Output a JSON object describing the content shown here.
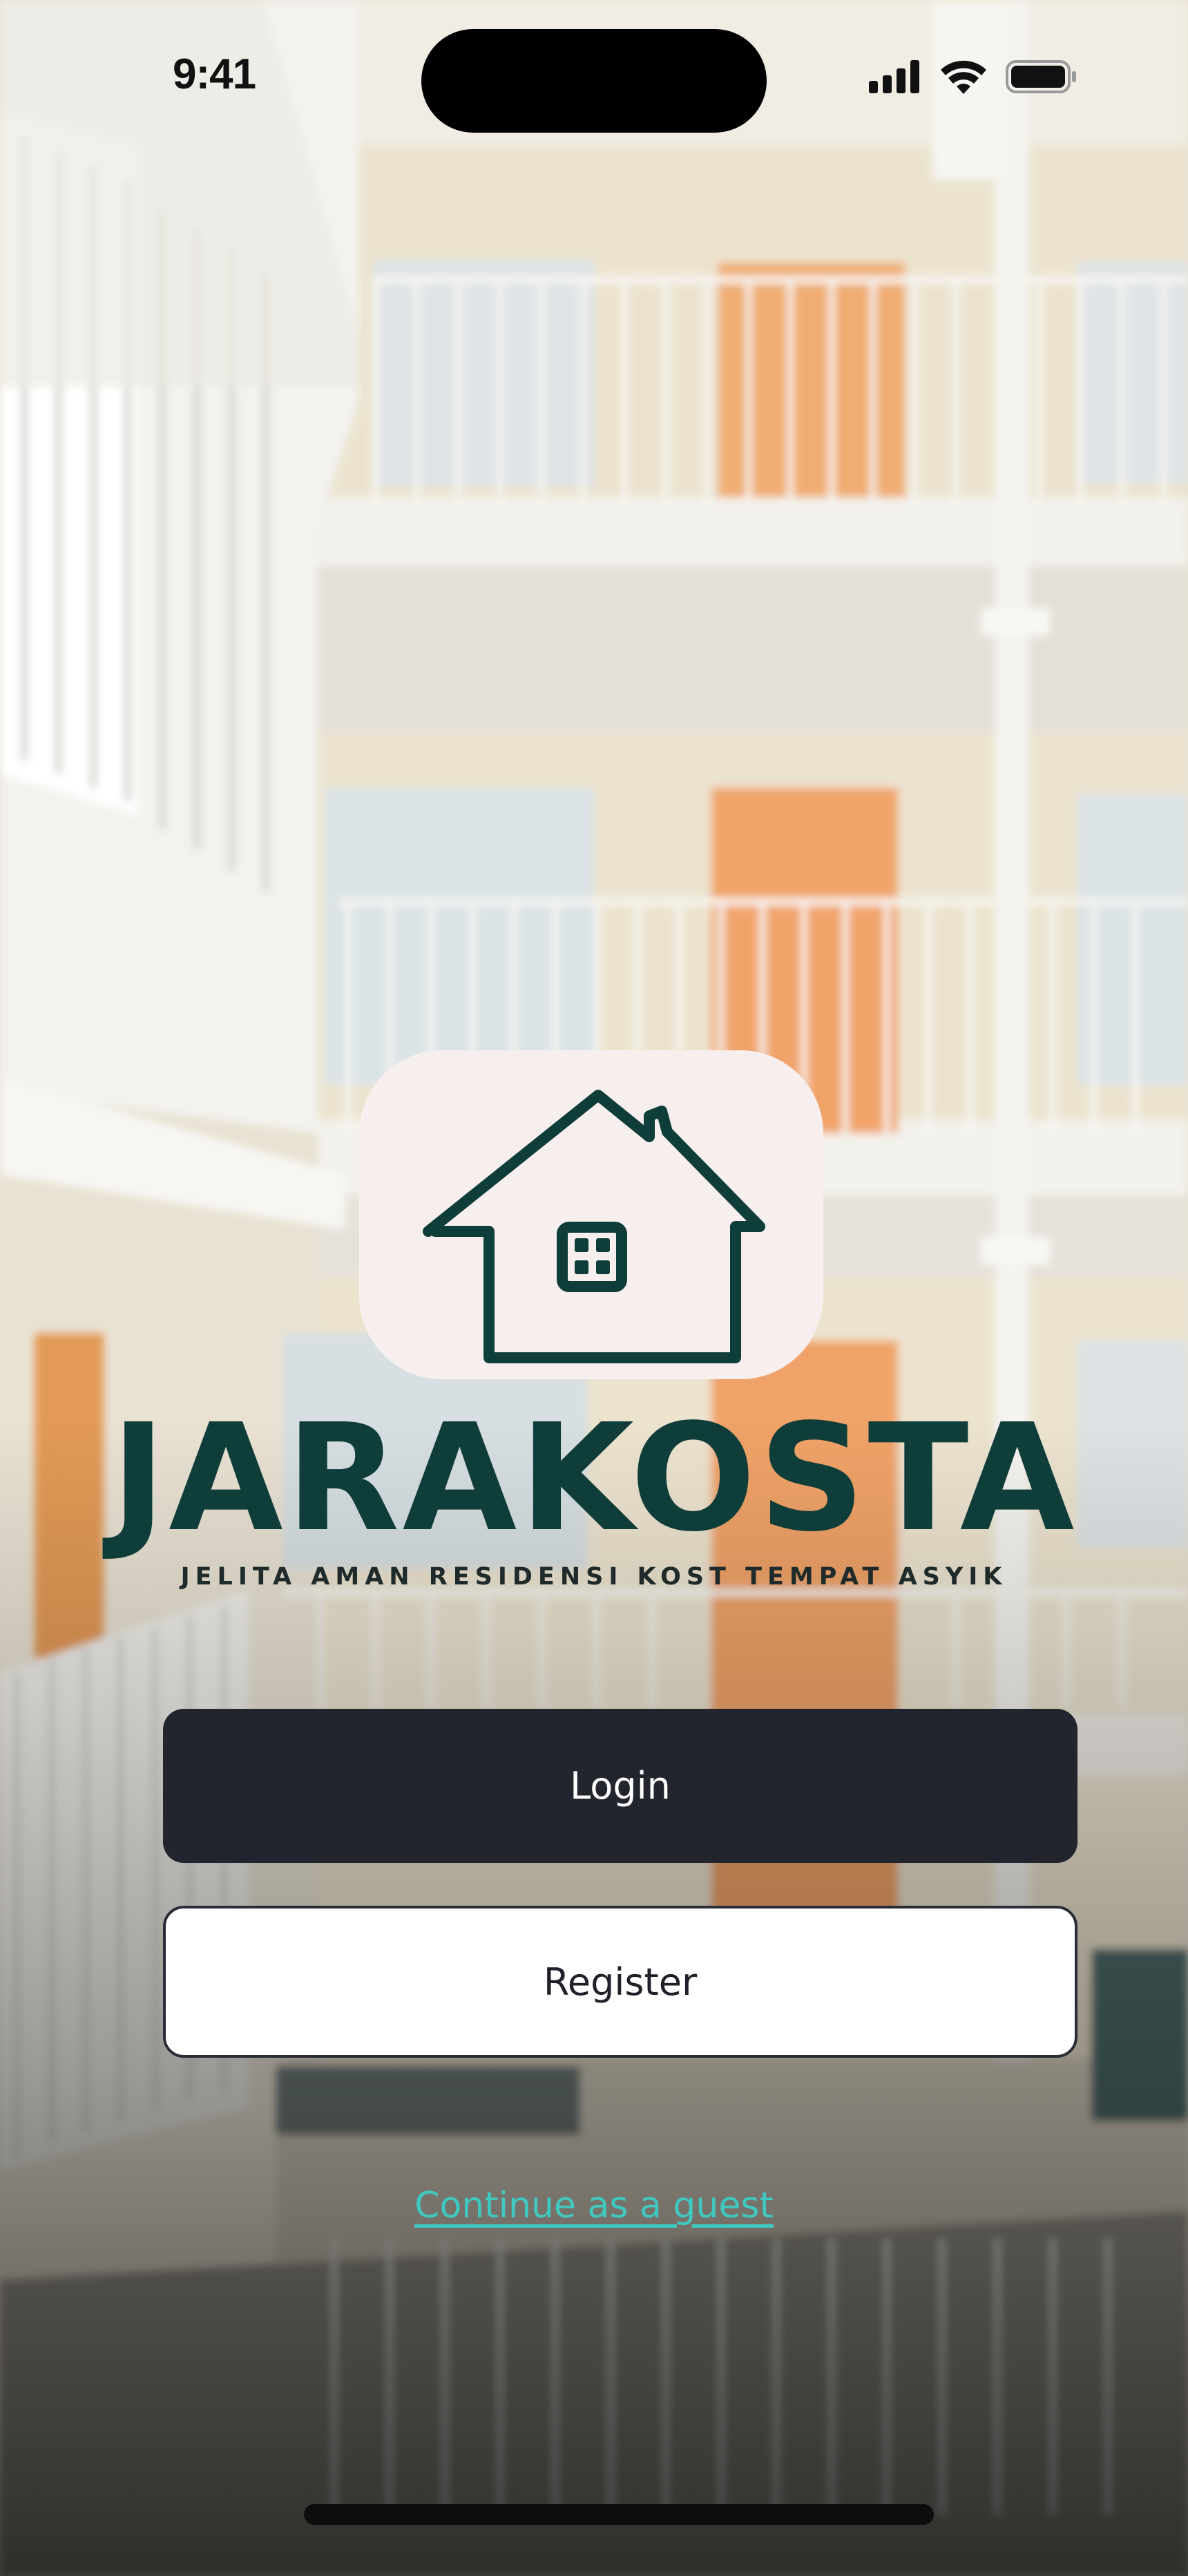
{
  "status_bar": {
    "time": "9:41",
    "icons": [
      "cellular-signal-icon",
      "wifi-icon",
      "battery-icon"
    ]
  },
  "brand": {
    "name": "JARAKOSTA",
    "tagline": "JELITA AMAN RESIDENSI KOST TEMPAT ASYIK",
    "logo_icon": "house-icon"
  },
  "actions": {
    "login_label": "Login",
    "register_label": "Register",
    "guest_label": "Continue as a guest"
  },
  "colors": {
    "brand_green": "#0f3d39",
    "logo_tile": "#f6efee",
    "login_button": "#22242e",
    "guest_link": "#3fc9c1"
  }
}
